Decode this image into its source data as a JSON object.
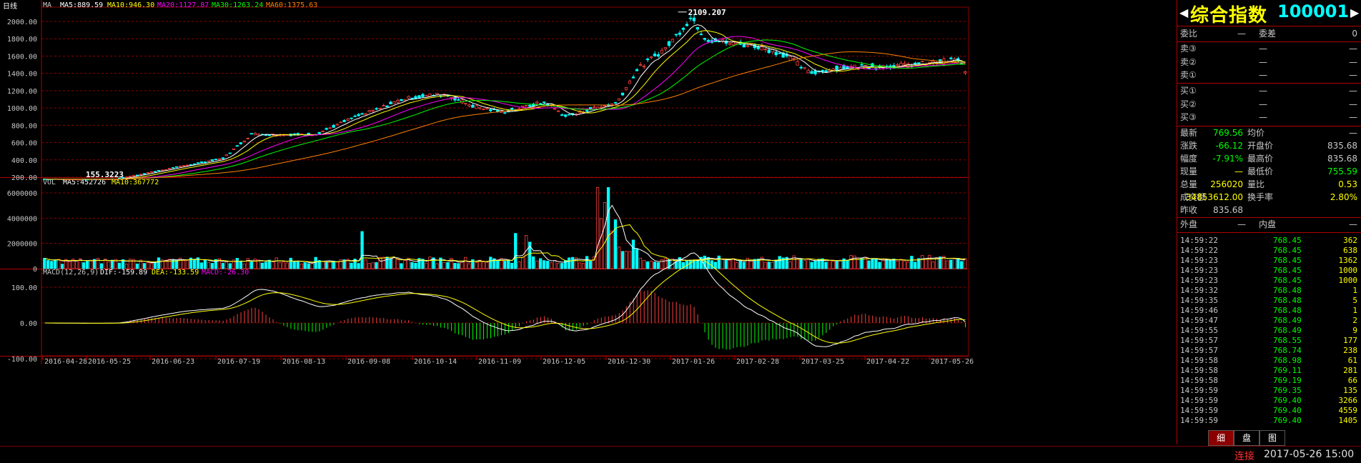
{
  "chart": {
    "period_label": "日线",
    "ma_header": {
      "label": "MA",
      "ma5": "MA5:889.59",
      "ma10": "MA10:946.30",
      "ma20": "MA20:1127.87",
      "ma30": "MA30:1263.24",
      "ma60": "MA60:1375.63"
    },
    "vol_header": {
      "label": "VOL",
      "ma5": "MA5:452726",
      "ma10": "MA10:367772"
    },
    "macd_header": {
      "label": "MACD(12,26,9)",
      "dif": "DIF:-159.89",
      "dea": "DEA:-133.59",
      "macd": "MACD:-26.30"
    },
    "high_annotation": "2109.207",
    "low_annotation": "155.3223",
    "price_ticks": [
      "2000.00",
      "1800.00",
      "1600.00",
      "1400.00",
      "1200.00",
      "1000.00",
      "800.00",
      "600.00",
      "400.00",
      "200.00"
    ],
    "vol_ticks": [
      "6000000",
      "4000000",
      "2000000",
      "0"
    ],
    "macd_ticks": [
      "100.00",
      "0.00",
      "-100.00"
    ],
    "date_ticks": [
      "2016-04-28",
      "2016-05-25",
      "2016-06-23",
      "2016-07-19",
      "2016-08-13",
      "2016-09-08",
      "2016-10-14",
      "2016-11-09",
      "2016-12-05",
      "2016-12-30",
      "2017-01-26",
      "2017-02-28",
      "2017-03-25",
      "2017-04-22",
      "2017-05-26"
    ],
    "colors": {
      "up": "#ff4040",
      "down": "#00ffff",
      "ma5": "#ffffff",
      "ma10": "#ffff00",
      "ma20": "#ff00ff",
      "ma30": "#00ff00",
      "ma60": "#ff8000",
      "grid": "#8b0000"
    }
  },
  "quote": {
    "title_name": "综合指数",
    "title_code": "100001",
    "weibi_label": "委比",
    "weibi_value": "—",
    "weicha_label": "委差",
    "weicha_value": "0",
    "asks": [
      {
        "label": "卖③",
        "price": "—",
        "vol": "—"
      },
      {
        "label": "卖②",
        "price": "—",
        "vol": "—"
      },
      {
        "label": "卖①",
        "price": "—",
        "vol": "—"
      }
    ],
    "bids": [
      {
        "label": "买①",
        "price": "—",
        "vol": "—"
      },
      {
        "label": "买②",
        "price": "—",
        "vol": "—"
      },
      {
        "label": "买③",
        "price": "—",
        "vol": "—"
      }
    ],
    "stats": [
      {
        "l1": "最新",
        "v1": "769.56",
        "l2": "均价",
        "v2": "—",
        "c1": "#00ff00",
        "c2": "#c8c8c8"
      },
      {
        "l1": "涨跌",
        "v1": "-66.12",
        "l2": "开盘价",
        "v2": "835.68",
        "c1": "#00ff00",
        "c2": "#c8c8c8"
      },
      {
        "l1": "幅度",
        "v1": "-7.91%",
        "l2": "最高价",
        "v2": "835.68",
        "c1": "#00ff00",
        "c2": "#c8c8c8"
      },
      {
        "l1": "现量",
        "v1": "—",
        "l2": "最低价",
        "v2": "755.59",
        "c1": "#ffff00",
        "c2": "#00ff00"
      },
      {
        "l1": "总量",
        "v1": "256020",
        "l2": "量比",
        "v2": "0.53",
        "c1": "#ffff00",
        "c2": "#ffff00"
      },
      {
        "l1": "成交额",
        "v1": "34853612.00",
        "l2": "换手率",
        "v2": "2.80%",
        "c1": "#ffff00",
        "c2": "#ffff00"
      },
      {
        "l1": "昨收",
        "v1": "835.68",
        "l2": "",
        "v2": "",
        "c1": "#c8c8c8",
        "c2": "#c8c8c8"
      }
    ],
    "outer_label": "外盘",
    "outer_value": "—",
    "inner_label": "内盘",
    "inner_value": "—",
    "ticks": [
      {
        "time": "14:59:22",
        "price": "768.45",
        "vol": "362"
      },
      {
        "time": "14:59:22",
        "price": "768.45",
        "vol": "638"
      },
      {
        "time": "14:59:23",
        "price": "768.45",
        "vol": "1362"
      },
      {
        "time": "14:59:23",
        "price": "768.45",
        "vol": "1000"
      },
      {
        "time": "14:59:23",
        "price": "768.45",
        "vol": "1000"
      },
      {
        "time": "14:59:32",
        "price": "768.48",
        "vol": "1"
      },
      {
        "time": "14:59:35",
        "price": "768.48",
        "vol": "5"
      },
      {
        "time": "14:59:46",
        "price": "768.48",
        "vol": "1"
      },
      {
        "time": "14:59:47",
        "price": "768.49",
        "vol": "2"
      },
      {
        "time": "14:59:55",
        "price": "768.49",
        "vol": "9"
      },
      {
        "time": "14:59:57",
        "price": "768.55",
        "vol": "177"
      },
      {
        "time": "14:59:57",
        "price": "768.74",
        "vol": "238"
      },
      {
        "time": "14:59:58",
        "price": "768.98",
        "vol": "61"
      },
      {
        "time": "14:59:58",
        "price": "769.11",
        "vol": "281"
      },
      {
        "time": "14:59:58",
        "price": "769.19",
        "vol": "66"
      },
      {
        "time": "14:59:59",
        "price": "769.35",
        "vol": "135"
      },
      {
        "time": "14:59:59",
        "price": "769.40",
        "vol": "3266"
      },
      {
        "time": "14:59:59",
        "price": "769.40",
        "vol": "4559"
      },
      {
        "time": "14:59:59",
        "price": "769.40",
        "vol": "1405"
      }
    ],
    "tabs": [
      "细",
      "盘",
      "图"
    ]
  },
  "status": {
    "connection": "连接",
    "datetime": "2017-05-26 15:00"
  }
}
